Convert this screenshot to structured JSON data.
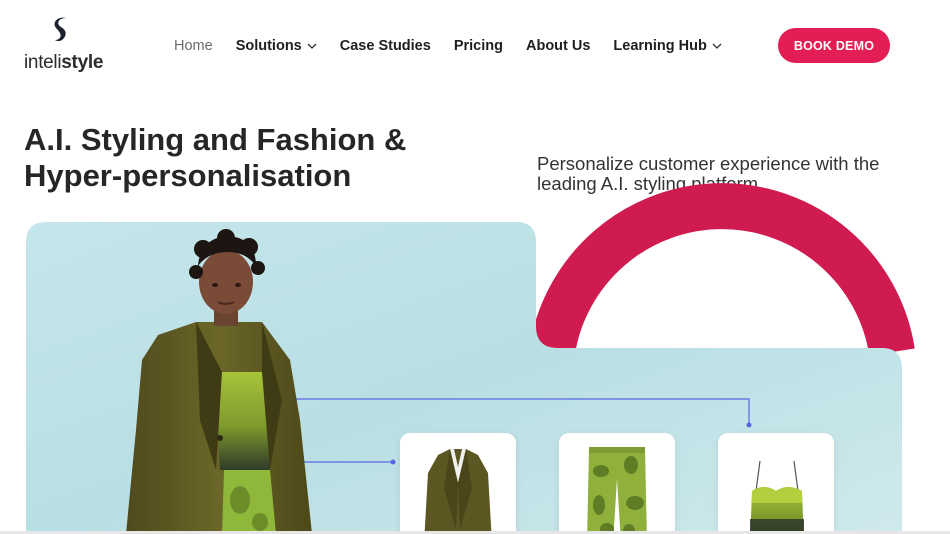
{
  "brand": {
    "name_light": "inteli",
    "name_bold": "style",
    "accent_color": "#e31e54"
  },
  "nav": {
    "items": [
      {
        "label": "Home",
        "active": true,
        "has_dropdown": false
      },
      {
        "label": "Solutions",
        "active": false,
        "has_dropdown": true
      },
      {
        "label": "Case Studies",
        "active": false,
        "has_dropdown": false
      },
      {
        "label": "Pricing",
        "active": false,
        "has_dropdown": false
      },
      {
        "label": "About Us",
        "active": false,
        "has_dropdown": false
      },
      {
        "label": "Learning Hub",
        "active": false,
        "has_dropdown": true
      }
    ],
    "cta_label": "BOOK DEMO"
  },
  "hero": {
    "title_line1": "A.I. Styling and Fashion &",
    "title_line2": "Hyper-personalisation",
    "subtitle_line1": "Personalize customer experience with the",
    "subtitle_line2": "leading A.I. styling platform"
  },
  "products": [
    {
      "icon": "blazer-icon"
    },
    {
      "icon": "pants-icon"
    },
    {
      "icon": "top-icon"
    }
  ]
}
